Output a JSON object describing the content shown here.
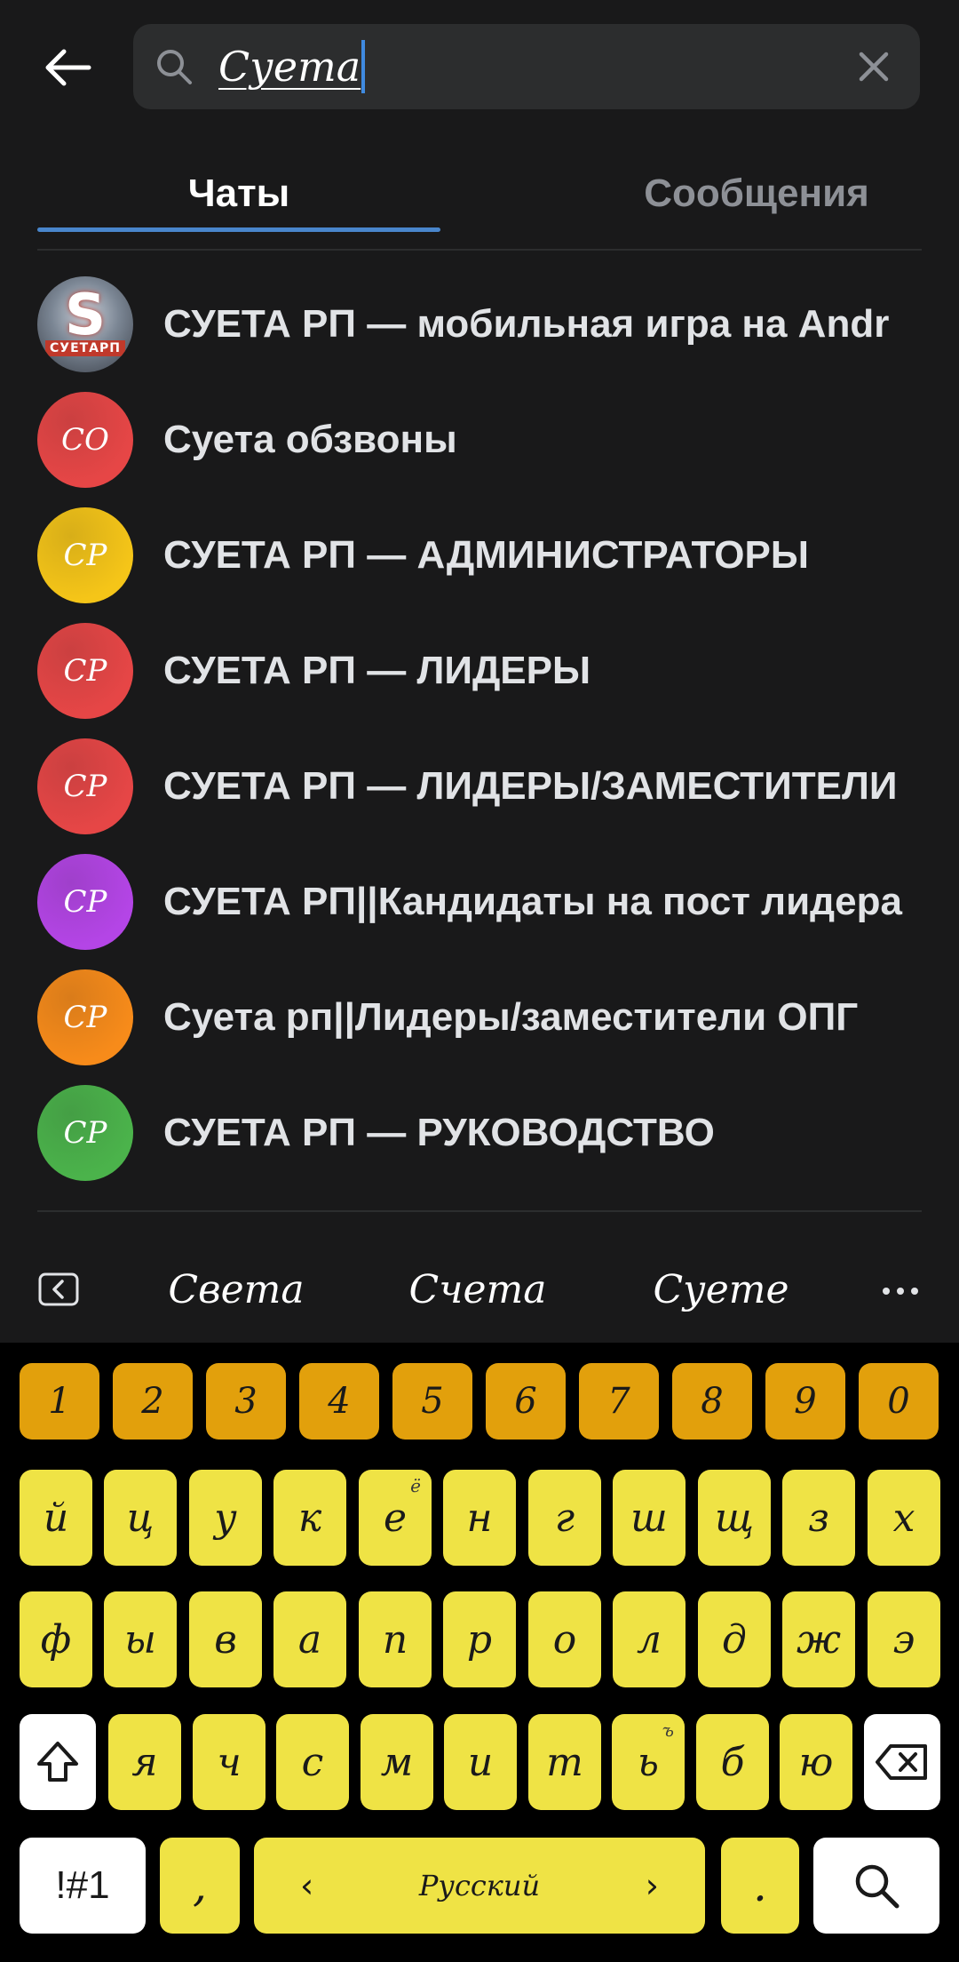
{
  "search": {
    "value": "Суета"
  },
  "tabs": [
    {
      "label": "Чаты",
      "active": true
    },
    {
      "label": "Сообщения",
      "active": false
    }
  ],
  "chats": [
    {
      "title": "СУЕТА РП — мобильная игра на Andr",
      "avatar_type": "logo",
      "logo_letter": "S",
      "logo_text": "СУЕТАРП"
    },
    {
      "title": "Суета обзвоны",
      "avatar_initials": "СО",
      "avatar_color": "#e64646"
    },
    {
      "title": "СУЕТА РП — АДМИНИСТРАТОРЫ",
      "avatar_initials": "СР",
      "avatar_color": "#f5c518"
    },
    {
      "title": "СУЕТА РП — ЛИДЕРЫ",
      "avatar_initials": "СР",
      "avatar_color": "#e64646"
    },
    {
      "title": "СУЕТА РП — ЛИДЕРЫ/ЗАМЕСТИТЕЛИ",
      "avatar_initials": "СР",
      "avatar_color": "#e64646"
    },
    {
      "title": "СУЕТА РП||Кандидаты на пост лидера",
      "avatar_initials": "СР",
      "avatar_color": "#b445e6"
    },
    {
      "title": "Суета рп||Лидеры/заместители ОПГ",
      "avatar_initials": "СР",
      "avatar_color": "#f78b1a"
    },
    {
      "title": "СУЕТА РП — РУКОВОДСТВО",
      "avatar_initials": "СР",
      "avatar_color": "#4bb34b"
    }
  ],
  "suggestions": [
    "Света",
    "Счета",
    "Суете"
  ],
  "keyboard": {
    "numbers": [
      "1",
      "2",
      "3",
      "4",
      "5",
      "6",
      "7",
      "8",
      "9",
      "0"
    ],
    "row1": [
      "й",
      "ц",
      "у",
      "к",
      "е",
      "н",
      "г",
      "ш",
      "щ",
      "з",
      "х"
    ],
    "row1_alt": {
      "е": "ё"
    },
    "row2": [
      "ф",
      "ы",
      "в",
      "а",
      "п",
      "р",
      "о",
      "л",
      "д",
      "ж",
      "э"
    ],
    "row3": [
      "я",
      "ч",
      "с",
      "м",
      "и",
      "т",
      "ь",
      "б",
      "ю"
    ],
    "row3_alt": {
      "ь": "ъ"
    },
    "symbols_label": "!#1",
    "comma": ",",
    "language": "Русский",
    "period": "."
  },
  "colors": {
    "background": "#19191a",
    "accent": "#4986cc",
    "number_keys": "#e2a00c",
    "letter_keys": "#efe345"
  }
}
